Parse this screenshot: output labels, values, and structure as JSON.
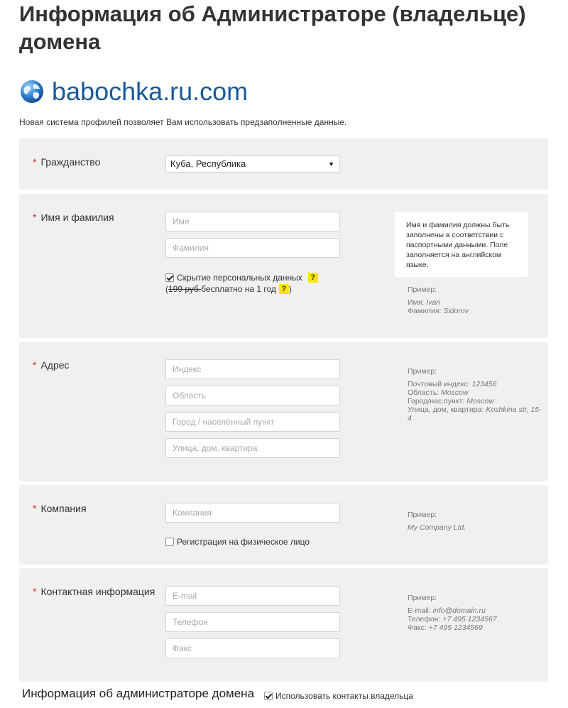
{
  "page": {
    "title": "Информация об Администраторе (владельце) домена",
    "domain": "babochka.ru.com",
    "intro": "Новая система профилей позволяет Вам использовать предзаполненные данные."
  },
  "citizenship": {
    "label": "Гражданство",
    "required": "*",
    "value": "Куба, Республика",
    "arrow": "▼"
  },
  "name": {
    "label": "Имя и фамилия",
    "required": "*",
    "first_placeholder": "Имя",
    "last_placeholder": "Фамилия",
    "privacy_label": "Скрытие персональных данных",
    "privacy_checked": true,
    "help": "?",
    "price_open": "(",
    "price_old": "199 руб.",
    "price_free": " бесплатно на 1 год",
    "price_close": ")",
    "tooltip": "Имя и фамилия должны быть заполнены в соответствии с паспортными данными. Поле заполняется на английском языке.",
    "example_title": "Пример:",
    "example_lines": [
      {
        "key": "Имя: ",
        "value": "Ivan"
      },
      {
        "key": "Фамилия: ",
        "value": "Sidorov"
      }
    ]
  },
  "address": {
    "label": "Адрес",
    "required": "*",
    "placeholders": [
      "Индекс",
      "Область",
      "Город / населённый пункт",
      "Улица, дом, квартира"
    ],
    "example_title": "Пример:",
    "example_lines": [
      {
        "key": "Почтовый индекс: ",
        "value": "123456"
      },
      {
        "key": "Область: ",
        "value": "Moscow"
      },
      {
        "key": "Город/нас.пункт: ",
        "value": "Moscow"
      },
      {
        "key": "Улица, дом, квартира: ",
        "value": "Koshkina str, 15-4"
      }
    ]
  },
  "company": {
    "label": "Компания",
    "required": "*",
    "placeholder": "Компания",
    "individual_label": "Регистрация на физическое лицо",
    "individual_checked": false,
    "example_title": "Пример:",
    "example_value": "My Company Ltd."
  },
  "contact": {
    "label": "Контактная информация",
    "required": "*",
    "placeholders": [
      "E-mail",
      "Телефон",
      "Факс"
    ],
    "example_title": "Пример:",
    "example_lines": [
      {
        "key": "E-mail: ",
        "value": "info@domain.ru"
      },
      {
        "key": "Телефон: ",
        "value": "+7 495 1234567"
      },
      {
        "key": "Факс: ",
        "value": "+7 495 1234569"
      }
    ]
  },
  "admin": {
    "label": "Информация об администраторе домена",
    "use_owner_label": "Использовать контакты владельца",
    "use_owner_checked": true
  },
  "colors": {
    "section_bg": "#f0f0f0",
    "domain_link": "#1a5a9a",
    "required_star": "#e0212b",
    "help_badge": "#ffe600"
  },
  "icons": {
    "domain": "globe-icon",
    "select": "dropdown-arrow-icon",
    "help": "question-mark-icon"
  }
}
